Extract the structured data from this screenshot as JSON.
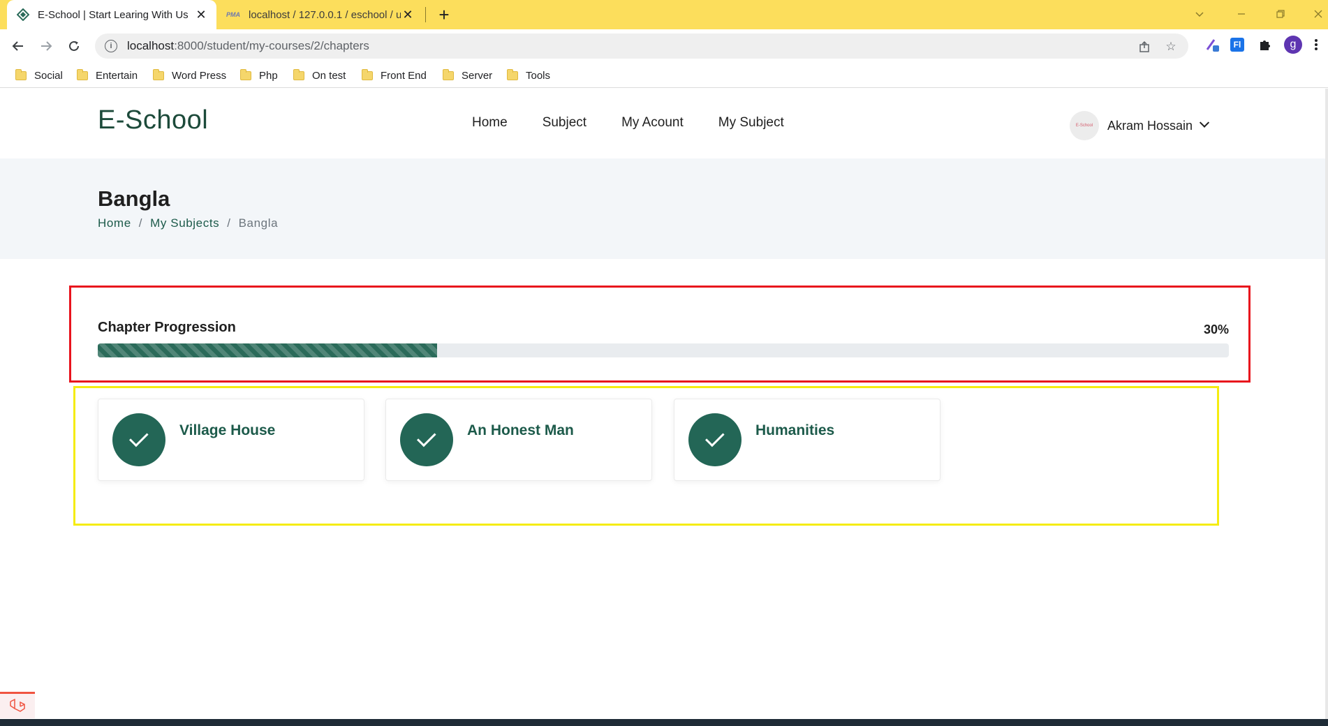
{
  "browser": {
    "tabs": [
      {
        "title": "E-School | Start Learing With Us",
        "active": true
      },
      {
        "title": "localhost / 127.0.0.1 / eschool / u",
        "active": false
      }
    ],
    "url_host": "localhost",
    "url_path": ":8000/student/my-courses/2/chapters",
    "profile_initial": "g",
    "bookmarks": [
      "Social",
      "Entertain",
      "Word Press",
      "Php",
      "On test",
      "Front End",
      "Server",
      "Tools"
    ]
  },
  "site": {
    "logo": "E-School",
    "nav": [
      "Home",
      "Subject",
      "My Acount",
      "My Subject"
    ],
    "user_name": "Akram Hossain",
    "avatar_text": "E-School"
  },
  "banner": {
    "title": "Bangla",
    "breadcrumb": [
      "Home",
      "My Subjects",
      "Bangla"
    ],
    "breadcrumb_sep": "/"
  },
  "progress": {
    "title": "Chapter Progression",
    "percent_label": "30%",
    "value": 0.3
  },
  "chapters": [
    {
      "title": "Village House",
      "completed": true
    },
    {
      "title": "An Honest Man",
      "completed": true
    },
    {
      "title": "Humanities",
      "completed": true
    }
  ],
  "colors": {
    "brand_green": "#236656",
    "progress_box_outline": "#e8141d",
    "chapters_box_outline": "#f5ec11",
    "chrome_yellow": "#fcde5c"
  }
}
